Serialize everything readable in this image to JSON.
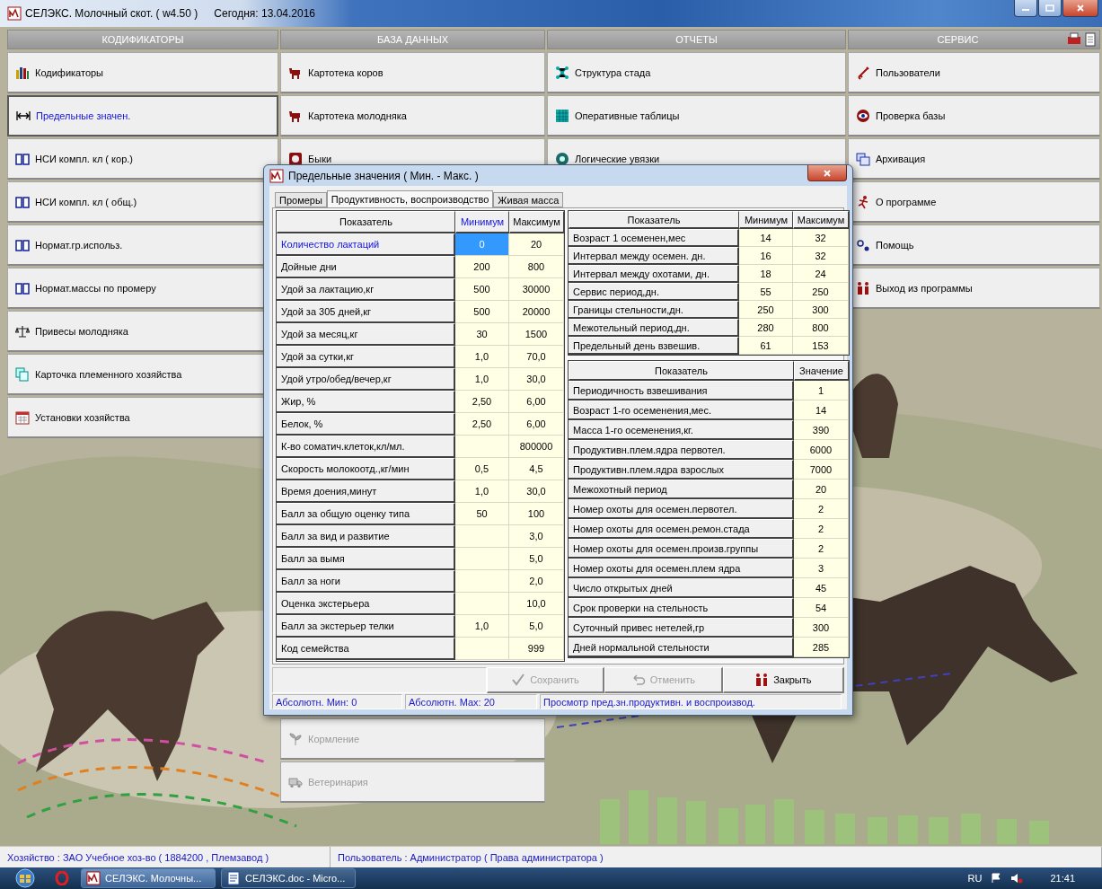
{
  "window": {
    "title": "СЕЛЭКС. Молочный скот. ( w4.50 )",
    "today": "Сегодня: 13.04.2016"
  },
  "columns": [
    {
      "title": "КОДИФИКАТОРЫ",
      "items": [
        {
          "label": "Кодификаторы",
          "selected": false,
          "disabled": false
        },
        {
          "label": "Предельные значен.",
          "selected": true,
          "disabled": false
        },
        {
          "label": "НСИ компл. кл ( кор.)",
          "selected": false,
          "disabled": false
        },
        {
          "label": "НСИ компл. кл ( общ.)",
          "selected": false,
          "disabled": false
        },
        {
          "label": "Нормат.гр.использ.",
          "selected": false,
          "disabled": false
        },
        {
          "label": "Нормат.массы по промеру",
          "selected": false,
          "disabled": false
        },
        {
          "label": "Привесы молодняка",
          "selected": false,
          "disabled": false
        },
        {
          "label": "Карточка племенного хозяйства",
          "selected": false,
          "disabled": false
        },
        {
          "label": "Установки хозяйства",
          "selected": false,
          "disabled": false
        }
      ]
    },
    {
      "title": "БАЗА ДАННЫХ",
      "items": [
        {
          "label": "Картотека коров",
          "selected": false,
          "disabled": false
        },
        {
          "label": "Картотека молодняка",
          "selected": false,
          "disabled": false
        },
        {
          "label": "Быки",
          "selected": false,
          "disabled": false
        }
      ],
      "more_items": [
        {
          "label": "Кормление",
          "selected": false,
          "disabled": true
        },
        {
          "label": "Ветеринария",
          "selected": false,
          "disabled": true
        }
      ]
    },
    {
      "title": "ОТЧЕТЫ",
      "items": [
        {
          "label": "Структура стада",
          "selected": false,
          "disabled": false
        },
        {
          "label": "Оперативные таблицы",
          "selected": false,
          "disabled": false
        },
        {
          "label": "Логические увязки",
          "selected": false,
          "disabled": false
        }
      ]
    },
    {
      "title": "СЕРВИС",
      "items": [
        {
          "label": "Пользователи",
          "selected": false,
          "disabled": false
        },
        {
          "label": "Проверка базы",
          "selected": false,
          "disabled": false
        },
        {
          "label": "Архивация",
          "selected": false,
          "disabled": false
        },
        {
          "label": "О программе",
          "selected": false,
          "disabled": false
        },
        {
          "label": "Помощь",
          "selected": false,
          "disabled": false
        },
        {
          "label": "Выход из программы",
          "selected": false,
          "disabled": false
        }
      ]
    }
  ],
  "dialog": {
    "title": "Предельные значения ( Мин. - Макс. )",
    "tabs": [
      {
        "label": "Промеры",
        "selected": false
      },
      {
        "label": "Продуктивность, воспроизводство",
        "selected": true
      },
      {
        "label": "Живая масса",
        "selected": false
      }
    ],
    "limits_table": {
      "columns": [
        {
          "label": "Показатель",
          "selected": false
        },
        {
          "label": "Минимум",
          "selected": true
        },
        {
          "label": "Максимум",
          "selected": false
        }
      ],
      "rows": [
        {
          "name": "Количество лактаций",
          "min": "0",
          "max": "20",
          "selected": true
        },
        {
          "name": "Дойные дни",
          "min": "200",
          "max": "800",
          "selected": false
        },
        {
          "name": "Удой за лактацию,кг",
          "min": "500",
          "max": "30000",
          "selected": false
        },
        {
          "name": "Удой за 305 дней,кг",
          "min": "500",
          "max": "20000",
          "selected": false
        },
        {
          "name": "Удой за месяц,кг",
          "min": "30",
          "max": "1500",
          "selected": false
        },
        {
          "name": "Удой за сутки,кг",
          "min": "1,0",
          "max": "70,0",
          "selected": false
        },
        {
          "name": "Удой утро/обед/вечер,кг",
          "min": "1,0",
          "max": "30,0",
          "selected": false
        },
        {
          "name": "Жир, %",
          "min": "2,50",
          "max": "6,00",
          "selected": false
        },
        {
          "name": "Белок, %",
          "min": "2,50",
          "max": "6,00",
          "selected": false
        },
        {
          "name": "К-во соматич.клеток,кл/мл.",
          "max": "800000",
          "selected": false
        },
        {
          "name": "Скорость молокоотд.,кг/мин",
          "min": "0,5",
          "max": "4,5",
          "selected": false
        },
        {
          "name": "Время доения,минут",
          "min": "1,0",
          "max": "30,0",
          "selected": false
        },
        {
          "name": "Балл за общую оценку типа",
          "min": "50",
          "max": "100",
          "selected": false
        },
        {
          "name": "Балл за вид и развитие",
          "max": "3,0",
          "selected": false
        },
        {
          "name": "Балл за вымя",
          "max": "5,0",
          "selected": false
        },
        {
          "name": "Балл за ноги",
          "max": "2,0",
          "selected": false
        },
        {
          "name": "Оценка экстерьера",
          "max": "10,0",
          "selected": false
        },
        {
          "name": "Балл за экстерьер телки",
          "min": "1,0",
          "max": "5,0",
          "selected": false
        },
        {
          "name": "Код семейства",
          "max": "999",
          "selected": false
        }
      ]
    },
    "reproduction_table": {
      "columns": [
        "Показатель",
        "Минимум",
        "Максимум"
      ],
      "rows": [
        {
          "name": "Возраст 1 осеменен,мес",
          "min": "14",
          "max": "32"
        },
        {
          "name": "Интервал между осемен. дн.",
          "min": "16",
          "max": "32"
        },
        {
          "name": "Интервал между охотами, дн.",
          "min": "18",
          "max": "24"
        },
        {
          "name": "Сервис период,дн.",
          "min": "55",
          "max": "250"
        },
        {
          "name": "Границы стельности,дн.",
          "min": "250",
          "max": "300"
        },
        {
          "name": "Межотельный период,дн.",
          "min": "280",
          "max": "800"
        },
        {
          "name": "Предельный день взвешив.",
          "min": "61",
          "max": "153"
        }
      ]
    },
    "values_table": {
      "columns": [
        "Показатель",
        "Значение"
      ],
      "rows": [
        {
          "name": "Периодичность взвешивания",
          "value": "1"
        },
        {
          "name": "Возраст 1-го осеменения,мес.",
          "value": "14"
        },
        {
          "name": "Масса 1-го осеменения,кг.",
          "value": "390"
        },
        {
          "name": "Продуктивн.плем.ядра первотел.",
          "value": "6000"
        },
        {
          "name": "Продуктивн.плем.ядра взрослых",
          "value": "7000"
        },
        {
          "name": "Межохотный период",
          "value": "20"
        },
        {
          "name": "Номер охоты для осемен.первотел.",
          "value": "2"
        },
        {
          "name": "Номер охоты для осемен.ремон.стада",
          "value": "2"
        },
        {
          "name": "Номер охоты для осемен.произв.группы",
          "value": "2"
        },
        {
          "name": "Номер охоты для осемен.плем ядра",
          "value": "3"
        },
        {
          "name": "Число открытых дней",
          "value": "45"
        },
        {
          "name": "Срок проверки на стельность",
          "value": "54"
        },
        {
          "name": "Суточный привес нетелей,гр",
          "value": "300"
        },
        {
          "name": "Дней нормальной стельности",
          "value": "285"
        }
      ]
    },
    "buttons": [
      {
        "label": "Сохранить",
        "disabled": true
      },
      {
        "label": "Отменить",
        "disabled": true
      },
      {
        "label": "Закрыть",
        "disabled": false
      }
    ],
    "status": [
      "Абсолютн. Мин: 0",
      "Абсолютн. Мах: 20",
      "Просмотр пред.зн.продуктивн. и  воспроизвод."
    ]
  },
  "status_bar": [
    "Хозяйство : ЗАО Учебное хоз-во ( 1884200 , Племзавод )",
    "Пользователь : Администратор ( Права администратора )"
  ],
  "taskbar": {
    "tasks": [
      {
        "label": "СЕЛЭКС. Молочны...",
        "selected": true
      },
      {
        "label": "СЕЛЭКС.doc - Micro...",
        "selected": false
      }
    ],
    "language": "RU",
    "time": "21:41"
  }
}
